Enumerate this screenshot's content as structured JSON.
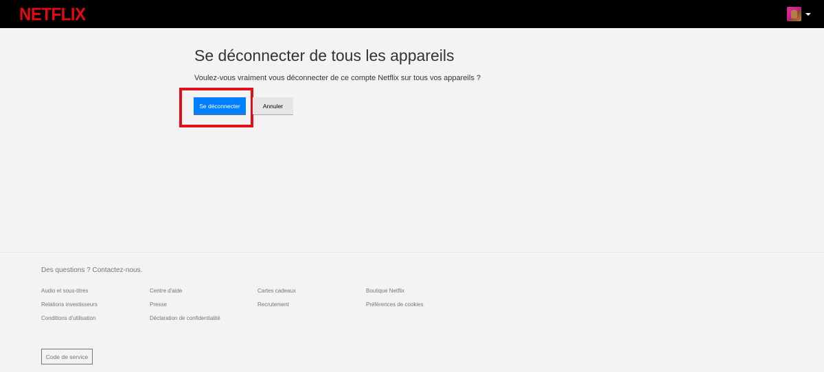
{
  "header": {
    "logo": "NETFLIX",
    "profile_icon": "profile-avatar",
    "caret_icon": "caret-down-icon"
  },
  "main": {
    "title": "Se déconnecter de tous les appareils",
    "question": "Voulez-vous vraiment vous déconnecter de ce compte Netflix sur tous vos appareils ?",
    "confirm_label": "Se déconnecter",
    "cancel_label": "Annuler"
  },
  "colors": {
    "brand": "#e50914",
    "primary_button": "#0080ff",
    "highlight_box": "#e10f1b"
  },
  "footer": {
    "contact": "Des questions ? Contactez-nous.",
    "columns": [
      [
        "Audio et sous-titres",
        "Relations investisseurs",
        "Conditions d'utilisation"
      ],
      [
        "Centre d'aide",
        "Presse",
        "Déclaration de confidentialité"
      ],
      [
        "Cartes cadeaux",
        "Recrutement"
      ],
      [
        "Boutique Netflix",
        "Préférences de cookies"
      ]
    ],
    "service_code": "Code de service"
  }
}
